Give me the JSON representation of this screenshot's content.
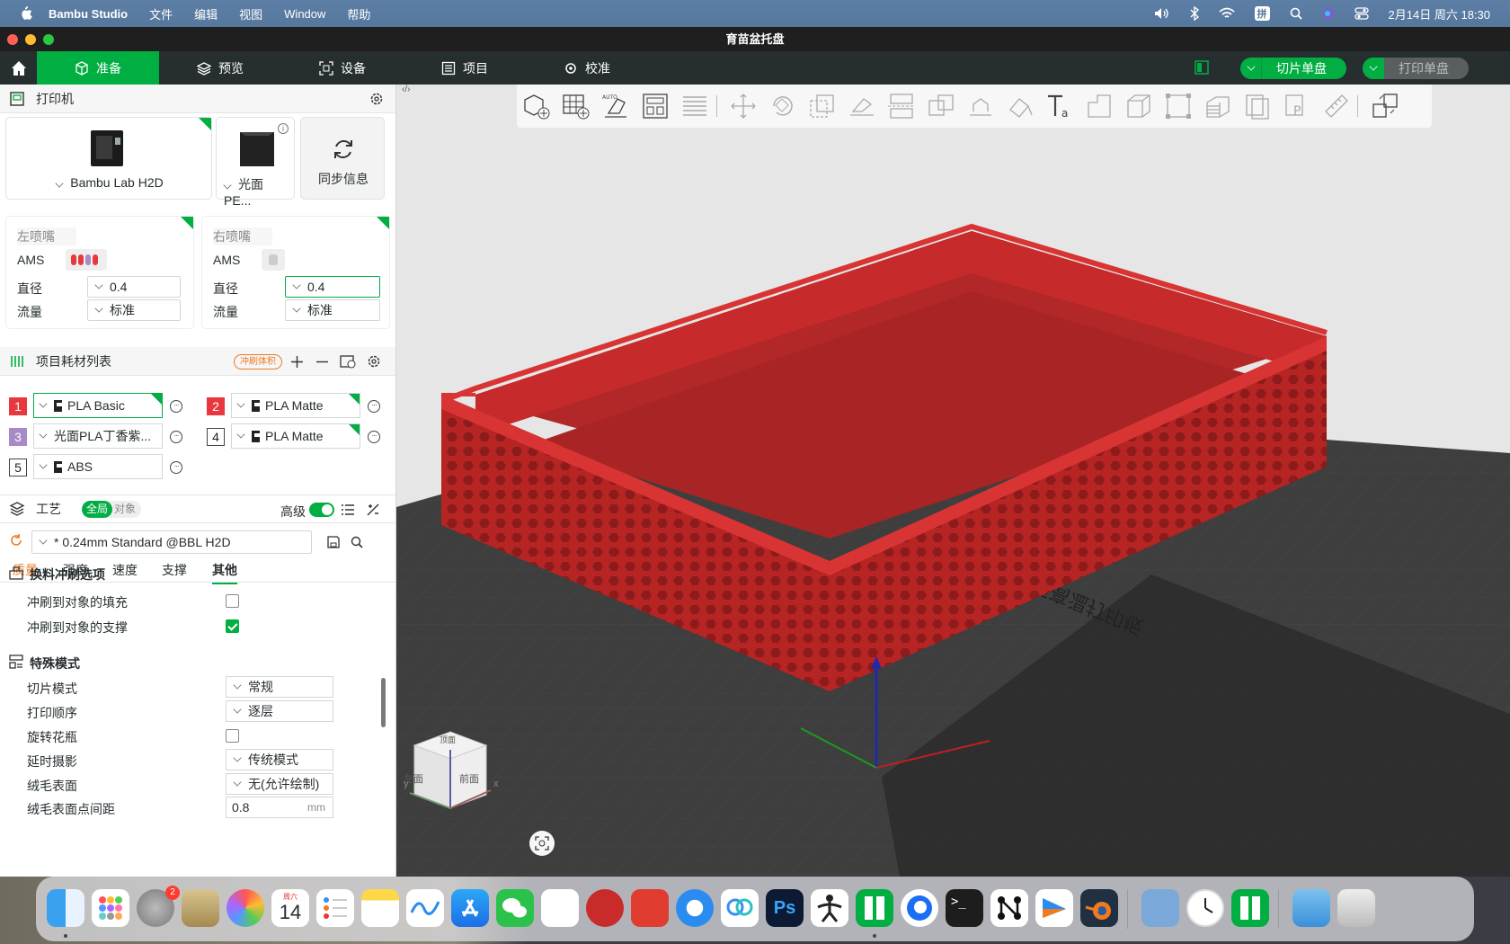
{
  "menubar": {
    "app_name": "Bambu Studio",
    "items": [
      "文件",
      "编辑",
      "视图",
      "Window",
      "帮助"
    ],
    "ime": "拼",
    "clock": "2月14日 周六  18:30"
  },
  "window": {
    "title": "育苗盆托盘"
  },
  "nav": {
    "tabs": [
      "准备",
      "预览",
      "设备",
      "项目",
      "校准"
    ],
    "slice_button": "切片单盘",
    "print_button": "打印单盘"
  },
  "printer": {
    "section_title": "打印机",
    "model": "Bambu Lab H2D",
    "plate": "光面 PE...",
    "sync_label": "同步信息",
    "left_nozzle": {
      "title": "左喷嘴",
      "ams_label": "AMS",
      "diameter_label": "直径",
      "diameter": "0.4",
      "flow_label": "流量",
      "flow": "标准"
    },
    "right_nozzle": {
      "title": "右喷嘴",
      "ams_label": "AMS",
      "diameter_label": "直径",
      "diameter": "0.4",
      "flow_label": "流量",
      "flow": "标准"
    }
  },
  "filaments": {
    "section_title": "项目耗材列表",
    "flush_badge": "冲刷体积",
    "items": [
      {
        "index": "1",
        "name": "PLA Basic",
        "color": "#e8383d"
      },
      {
        "index": "2",
        "name": "PLA Matte",
        "color": "#e8383d"
      },
      {
        "index": "3",
        "name": "光面PLA丁香紫...",
        "color": "#a88ac6"
      },
      {
        "index": "4",
        "name": "PLA Matte",
        "color": "#ffffff"
      },
      {
        "index": "5",
        "name": "ABS",
        "color": "#ffffff"
      }
    ]
  },
  "process": {
    "section_title": "工艺",
    "scope_global": "全局",
    "scope_object": "对象",
    "advanced_label": "高级",
    "preset": "* 0.24mm Standard @BBL H2D",
    "tabs": [
      "质量",
      "强度",
      "速度",
      "支撑",
      "其他"
    ],
    "active_tab": "其他",
    "group_flush": "换料冲刷选项",
    "flush_infill_label": "冲刷到对象的填充",
    "flush_infill": false,
    "flush_support_label": "冲刷到对象的支撑",
    "flush_support": true,
    "group_special": "特殊模式",
    "slice_mode_label": "切片模式",
    "slice_mode": "常规",
    "print_order_label": "打印顺序",
    "print_order": "逐层",
    "spiral_label": "旋转花瓶",
    "spiral": false,
    "timelapse_label": "延时摄影",
    "timelapse": "传统模式",
    "fuzzy_label": "绒毛表面",
    "fuzzy": "无(允许绘制)",
    "fuzzy_dist_label": "绒毛表面点间距",
    "fuzzy_dist": "0.8",
    "fuzzy_dist_unit": "mm"
  },
  "viewport": {
    "cube_left": "左面",
    "cube_front": "前面",
    "cube_top": "顶面",
    "axis_x": "x",
    "axis_y": "y",
    "model_color": "#cc2f2f",
    "plate_text": "光面高温打印板"
  },
  "dock": {
    "settings_badge": "2",
    "calendar_weekday": "周六",
    "calendar_day": "14"
  }
}
